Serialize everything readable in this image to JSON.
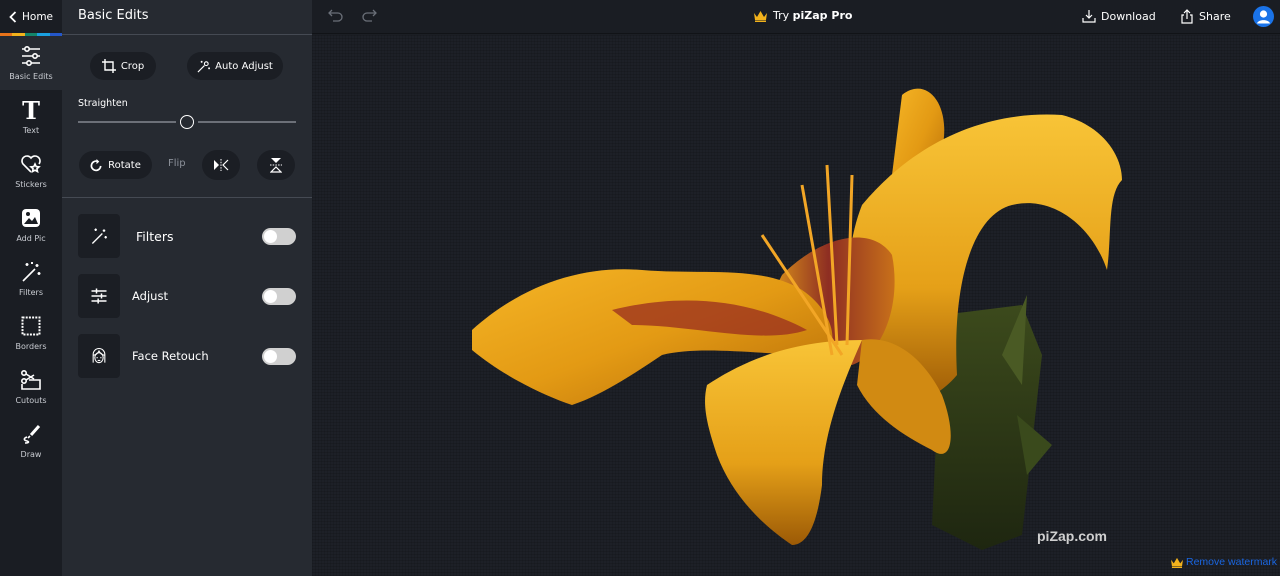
{
  "rail": {
    "home_label": "Home",
    "rainbow_colors": [
      "#e8731a",
      "#f2b21c",
      "#13856a",
      "#1aa0e0",
      "#2457c9"
    ],
    "items": [
      {
        "label": "Basic Edits",
        "icon": "sliders-icon",
        "active": true
      },
      {
        "label": "Text",
        "icon": "text-icon",
        "active": false
      },
      {
        "label": "Stickers",
        "icon": "heart-star-icon",
        "active": false
      },
      {
        "label": "Add Pic",
        "icon": "image-icon",
        "active": false
      },
      {
        "label": "Filters",
        "icon": "magic-wand-icon",
        "active": false
      },
      {
        "label": "Borders",
        "icon": "border-frame-icon",
        "active": false
      },
      {
        "label": "Cutouts",
        "icon": "scissors-icon",
        "active": false
      },
      {
        "label": "Draw",
        "icon": "brush-icon",
        "active": false
      }
    ]
  },
  "panel": {
    "title": "Basic Edits",
    "crop_label": "Crop",
    "auto_adjust_label": "Auto Adjust",
    "straighten_label": "Straighten",
    "straighten_value_fraction": 0.5,
    "rotate_label": "Rotate",
    "flip_label": "Flip",
    "tools": [
      {
        "label": "Filters",
        "icon": "magic-wand-icon",
        "enabled": false
      },
      {
        "label": "Adjust",
        "icon": "sliders-icon",
        "enabled": false
      },
      {
        "label": "Face Retouch",
        "icon": "face-icon",
        "enabled": false
      }
    ]
  },
  "topbar": {
    "try_prefix": "Try ",
    "try_brand": "piZap Pro",
    "download_label": "Download",
    "share_label": "Share",
    "crown_color": "#f2b21c",
    "avatar_color": "#1a73e8"
  },
  "canvas": {
    "watermark": "piZap.com",
    "remove_watermark_label": "Remove watermark",
    "link_color": "#1a66e0"
  }
}
